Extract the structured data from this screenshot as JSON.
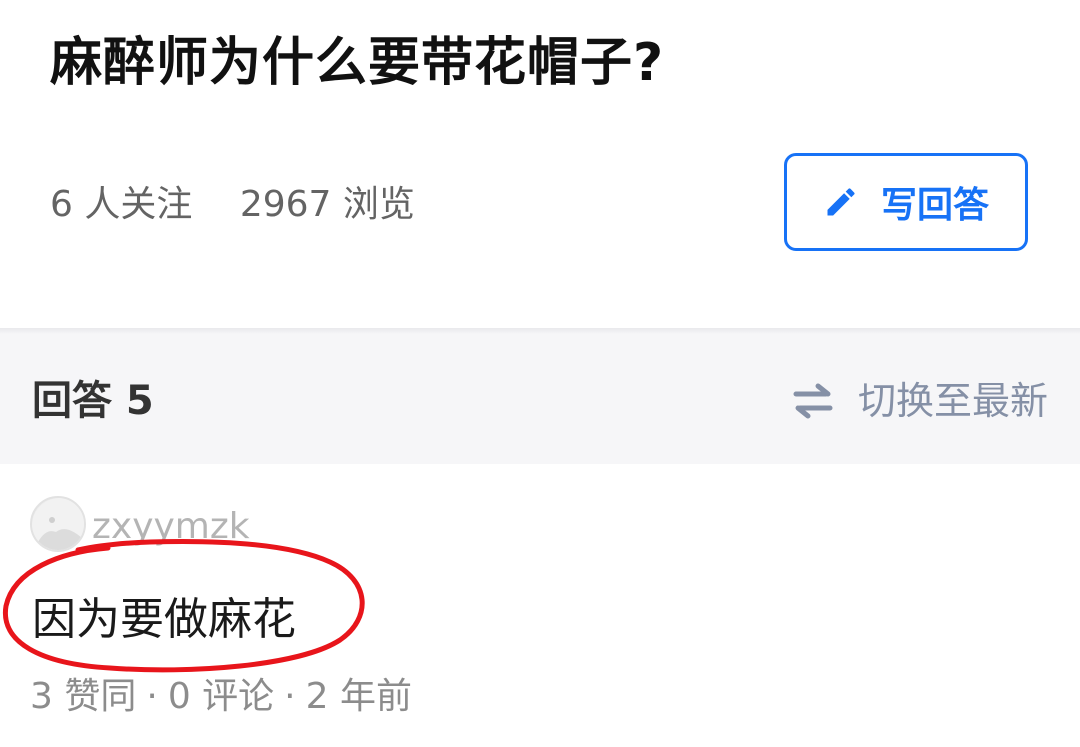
{
  "question": {
    "title": "麻醉师为什么要带花帽子?",
    "followers": "6 人关注",
    "views": "2967 浏览"
  },
  "actions": {
    "write_answer_label": "写回答",
    "accent_color": "#1772f6"
  },
  "answers_section": {
    "count_label": "回答 5",
    "sort_toggle_label": "切换至最新"
  },
  "answer": {
    "author": "zxyymzk",
    "content": "因为要做麻花",
    "stats": {
      "likes": "3 赞同",
      "comments": "0 评论",
      "time": "2 年前",
      "separator": "·"
    },
    "annotation_color": "#e8151b"
  },
  "icons": {
    "write": "pencil-icon",
    "sort": "swap-arrows-icon",
    "avatar": "user-avatar"
  }
}
